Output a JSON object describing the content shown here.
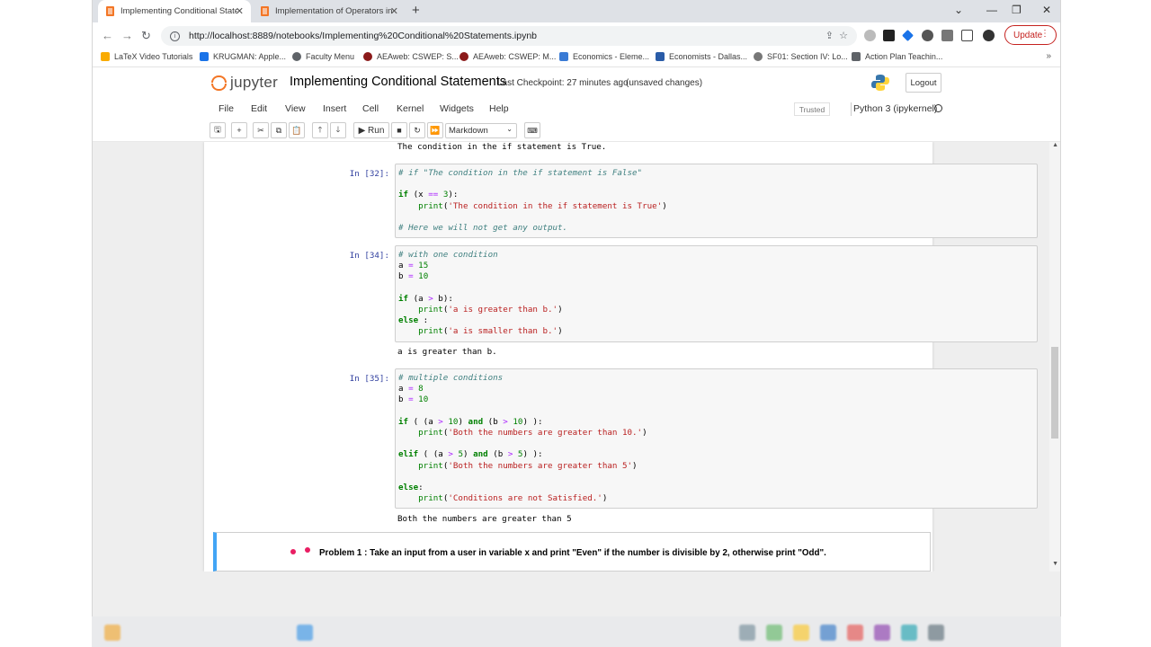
{
  "browser": {
    "tabs": [
      {
        "label": "Implementing Conditional State",
        "active": true
      },
      {
        "label": "Implementation of Operators in",
        "active": false
      }
    ],
    "url": "http://localhost:8889/notebooks/Implementing%20Conditional%20Statements.ipynb",
    "update_label": "Update",
    "bookmarks": [
      {
        "label": "LaTeX Video Tutorials",
        "color": "#f9ab00"
      },
      {
        "label": "KRUGMAN: Apple...",
        "color": "#1a73e8"
      },
      {
        "label": "Faculty Menu",
        "color": "#5f6368"
      },
      {
        "label": "AEAweb: CSWEP: S...",
        "color": "#8b1a1a"
      },
      {
        "label": "AEAweb: CSWEP: M...",
        "color": "#8b1a1a"
      },
      {
        "label": "Economics - Eleme...",
        "color": "#3a7bd5"
      },
      {
        "label": "Economists - Dallas...",
        "color": "#2a5ca8"
      },
      {
        "label": "SF01: Section IV: Lo...",
        "color": "#777777"
      },
      {
        "label": "Action Plan Teachin...",
        "color": "#5f6368"
      }
    ]
  },
  "jupyter": {
    "logo_text": "jupyter",
    "notebook_title": "Implementing Conditional Statements",
    "checkpoint": "Last Checkpoint: 27 minutes ago",
    "save_status": "(unsaved changes)",
    "logout_label": "Logout",
    "menu": [
      "File",
      "Edit",
      "View",
      "Insert",
      "Cell",
      "Kernel",
      "Widgets",
      "Help"
    ],
    "trusted_label": "Trusted",
    "kernel_name": "Python 3 (ipykernel)",
    "run_label": "Run",
    "cell_type": "Markdown"
  },
  "notebook": {
    "prev_output": "The condition in the if statement is True.",
    "cells": [
      {
        "prompt": "In [32]:"
      },
      {
        "prompt": "In [34]:",
        "output": "a is greater than b."
      },
      {
        "prompt": "In [35]:",
        "output": "Both the numbers are greater than 5"
      }
    ],
    "problem_text": "Problem 1 : Take an input from a user in variable x and print \"Even\" if the number is divisible by 2, otherwise print \"Odd\"."
  },
  "colors": {
    "jupyter_orange": "#f37626",
    "prompt_blue": "#303f9f",
    "markdown_selected": "#42a5f5"
  }
}
